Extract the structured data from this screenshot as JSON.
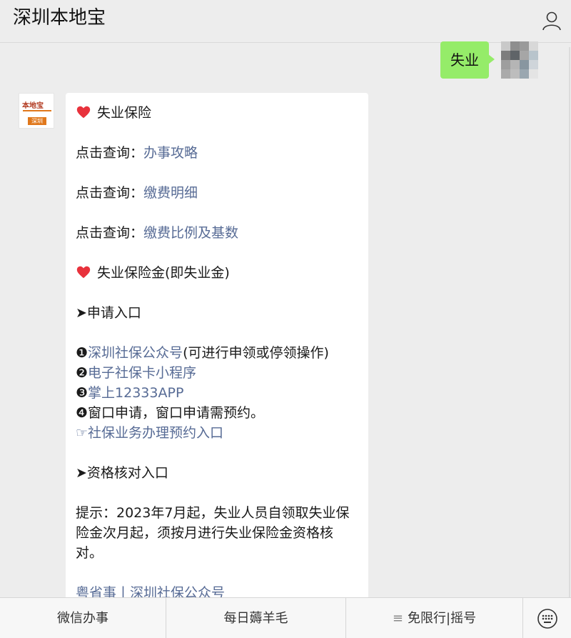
{
  "header": {
    "title": "深圳本地宝",
    "profile_icon": "person-icon"
  },
  "outgoing": {
    "text": "失业"
  },
  "account_logo": {
    "text": "本地宝",
    "tag": "深圳"
  },
  "message": {
    "heading1": "失业保险",
    "query_prefix": "点击查询：",
    "queries": [
      "办事攻略",
      "缴费明细",
      "缴费比例及基数"
    ],
    "heading2": "失业保险金(即失业金)",
    "section_apply": "➤申请入口",
    "apply_items": [
      {
        "marker": "❶",
        "link": "深圳社保公众号",
        "note": "(可进行申领或停领操作)"
      },
      {
        "marker": "❷",
        "link": "电子社保卡小程序",
        "note": ""
      },
      {
        "marker": "❸",
        "link": "掌上12333APP",
        "note": ""
      },
      {
        "marker": "❹",
        "link": "",
        "note": "窗口申请，窗口申请需预约。"
      }
    ],
    "appointment": {
      "marker": "☞",
      "link": "社保业务办理预约入口"
    },
    "section_verify": "➤资格核对入口",
    "tip": "提示：2023年7月起，失业人员自领取失业保险金次月起，须按月进行失业保险金资格核对。",
    "cut_link": "粤省事丨深圳社保公众号"
  },
  "menu": {
    "items": [
      "微信办事",
      "每日薅羊毛",
      "免限行|摇号"
    ],
    "menu_glyph": "≡",
    "keyboard_icon": "keyboard-icon"
  },
  "colors": {
    "link": "#576b95",
    "outgoing_bubble": "#95ec69",
    "heart": "#e8323c"
  }
}
